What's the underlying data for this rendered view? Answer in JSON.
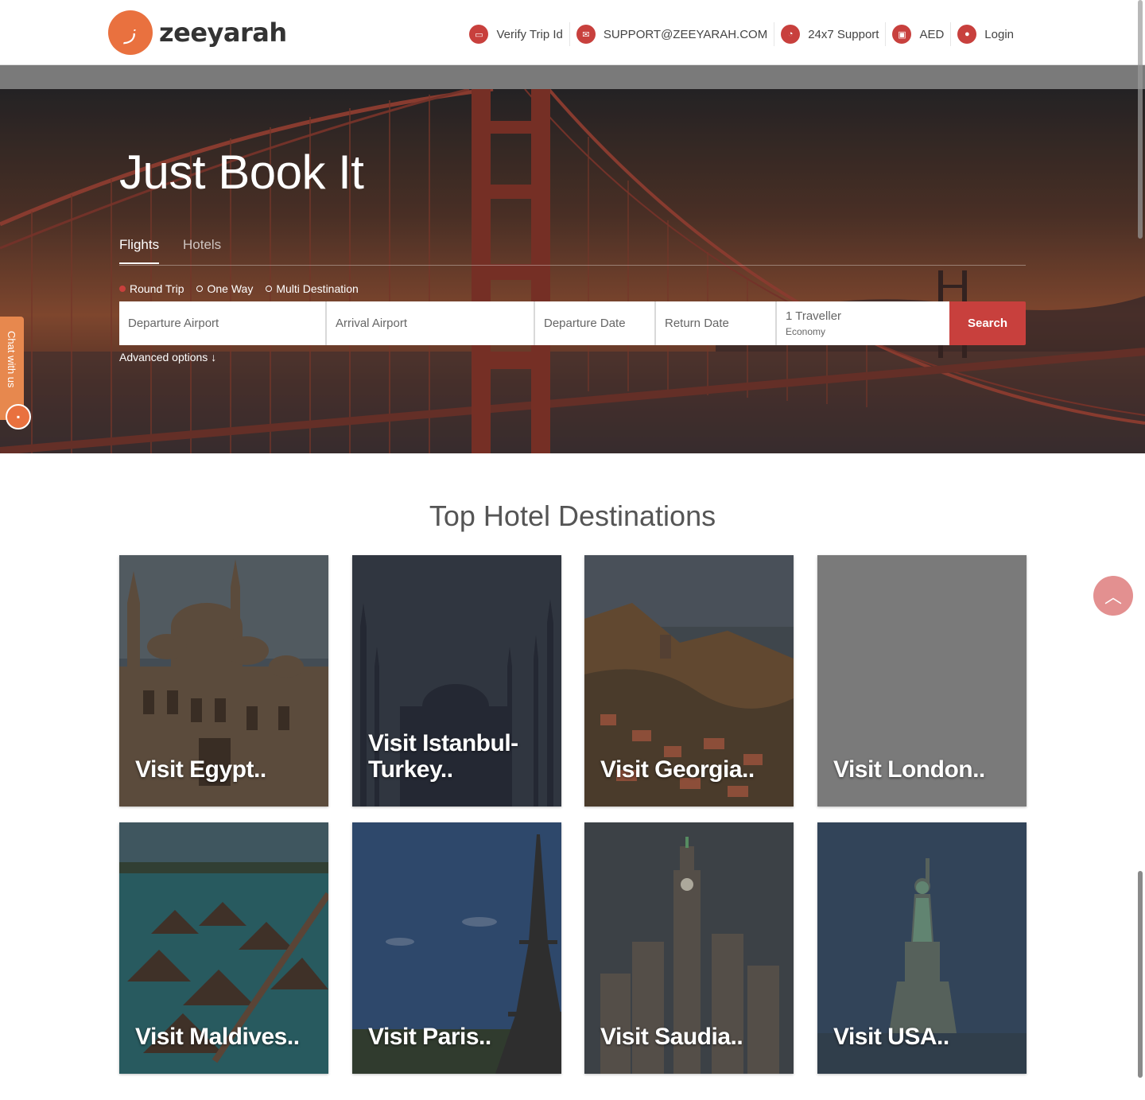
{
  "header": {
    "logo_text": "zeeyarah",
    "nav": [
      {
        "label": "Verify Trip Id",
        "icon": "id-card-icon"
      },
      {
        "label": "SUPPORT@ZEEYARAH.COM",
        "icon": "envelope-icon"
      },
      {
        "label": "24x7 Support",
        "icon": "chat-bubbles-icon"
      },
      {
        "label": "AED",
        "icon": "money-icon"
      },
      {
        "label": "Login",
        "icon": "user-icon"
      }
    ]
  },
  "hero": {
    "title": "Just Book It",
    "tabs": [
      {
        "label": "Flights",
        "active": true
      },
      {
        "label": "Hotels",
        "active": false
      }
    ],
    "trip_types": [
      {
        "label": "Round Trip",
        "selected": true
      },
      {
        "label": "One Way",
        "selected": false
      },
      {
        "label": "Multi Destination",
        "selected": false
      }
    ],
    "fields": {
      "departure_airport": "Departure Airport",
      "arrival_airport": "Arrival Airport",
      "departure_date": "Departure Date",
      "return_date": "Return Date",
      "travellers": "1 Traveller",
      "cabin_class": "Economy"
    },
    "search_label": "Search",
    "advanced_label": "Advanced options"
  },
  "chat": {
    "label": "Chat with us"
  },
  "destinations": {
    "title": "Top Hotel Destinations",
    "cards": [
      {
        "label": "Visit Egypt.."
      },
      {
        "label": "Visit Istanbul-Turkey.."
      },
      {
        "label": "Visit Georgia.."
      },
      {
        "label": "Visit London.."
      },
      {
        "label": "Visit Maldives.."
      },
      {
        "label": "Visit Paris.."
      },
      {
        "label": "Visit Saudia.."
      },
      {
        "label": "Visit USA.."
      }
    ]
  },
  "colors": {
    "accent": "#c8403d",
    "brand_orange": "#e9713f",
    "scroll_top": "#e39090"
  }
}
